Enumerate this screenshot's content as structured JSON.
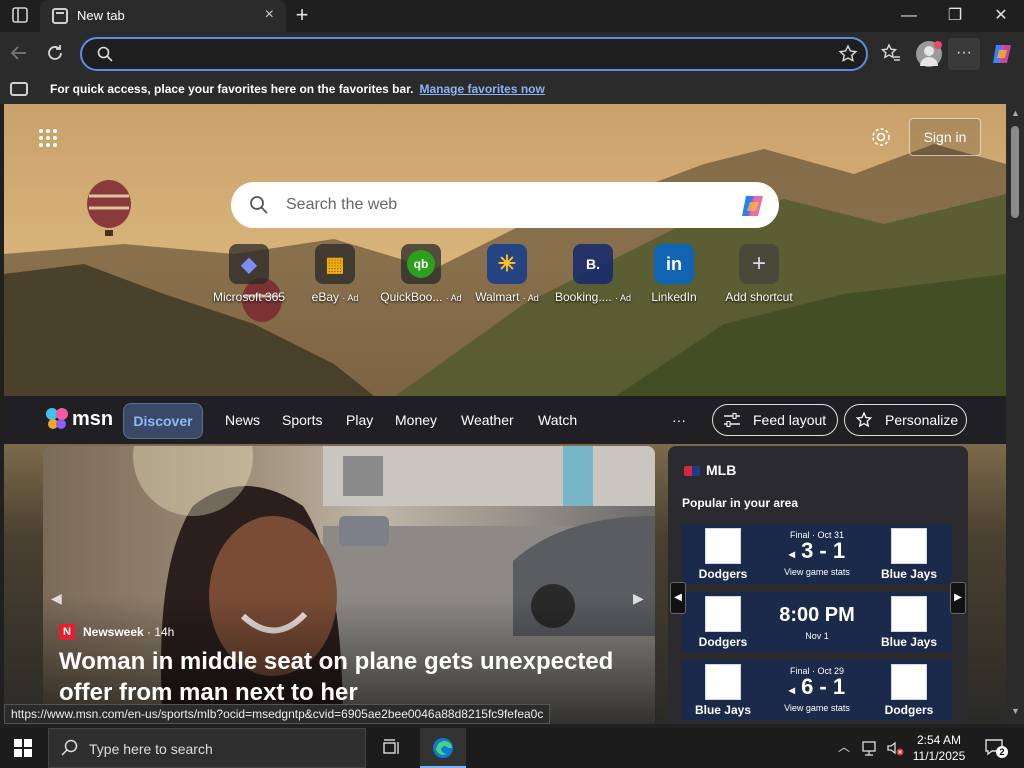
{
  "browser": {
    "tab_title": "New tab",
    "tab_close": "×",
    "new_tab": "+",
    "window": {
      "minimize": "—",
      "maximize": "❐",
      "close": "✕"
    }
  },
  "favorites_bar": {
    "message": "For quick access, place your favorites here on the favorites bar.",
    "link": "Manage favorites now"
  },
  "newtab": {
    "sign_in": "Sign in",
    "search_placeholder": "Search the web",
    "shortcuts": [
      {
        "label": "Microsoft 365",
        "ad": "",
        "glyph": "◆",
        "color": "#6a7cf2"
      },
      {
        "label": "eBay",
        "ad": "· Ad",
        "glyph": "▦",
        "color": "#e53238"
      },
      {
        "label": "QuickBoo...",
        "ad": "· Ad",
        "glyph": "qb",
        "color": "#2ca01c"
      },
      {
        "label": "Walmart",
        "ad": "· Ad",
        "glyph": "✳",
        "color": "#ffc220"
      },
      {
        "label": "Booking....",
        "ad": "· Ad",
        "glyph": "B.",
        "color": "#ffffff"
      },
      {
        "label": "LinkedIn",
        "ad": "",
        "glyph": "in",
        "color": "#ffffff"
      },
      {
        "label": "Add shortcut",
        "ad": "",
        "glyph": "+",
        "color": "#cfcfcf"
      }
    ]
  },
  "msn": {
    "logo": "msn",
    "tabs": [
      "Discover",
      "News",
      "Sports",
      "Play",
      "Money",
      "Weather",
      "Watch"
    ],
    "more": "···",
    "feed_layout": "Feed layout",
    "personalize": "Personalize"
  },
  "hero": {
    "source": "Newsweek",
    "age": "· 14h",
    "title": "Woman in middle seat on plane gets unexpected offer from man next to her"
  },
  "mlb": {
    "title": "MLB",
    "subtitle": "Popular in your area",
    "games": [
      {
        "status": "Final · Oct 31",
        "score": "3 - 1",
        "arrow": "◂",
        "detail": "View game stats",
        "home": "Dodgers",
        "away": "Blue Jays"
      },
      {
        "status": "",
        "score": "8:00 PM",
        "arrow": "",
        "detail": "Nov 1",
        "home": "Dodgers",
        "away": "Blue Jays"
      },
      {
        "status": "Final · Oct 29",
        "score": "6 - 1",
        "arrow": "◂",
        "detail": "View game stats",
        "home": "Blue Jays",
        "away": "Dodgers"
      }
    ]
  },
  "status_url": "https://www.msn.com/en-us/sports/mlb?ocid=msedgntp&cvid=6905ae2bee0046a88d8215fc9fefea0c",
  "taskbar": {
    "search_placeholder": "Type here to search",
    "time": "2:54 AM",
    "date": "11/1/2025",
    "notifications": "2"
  }
}
